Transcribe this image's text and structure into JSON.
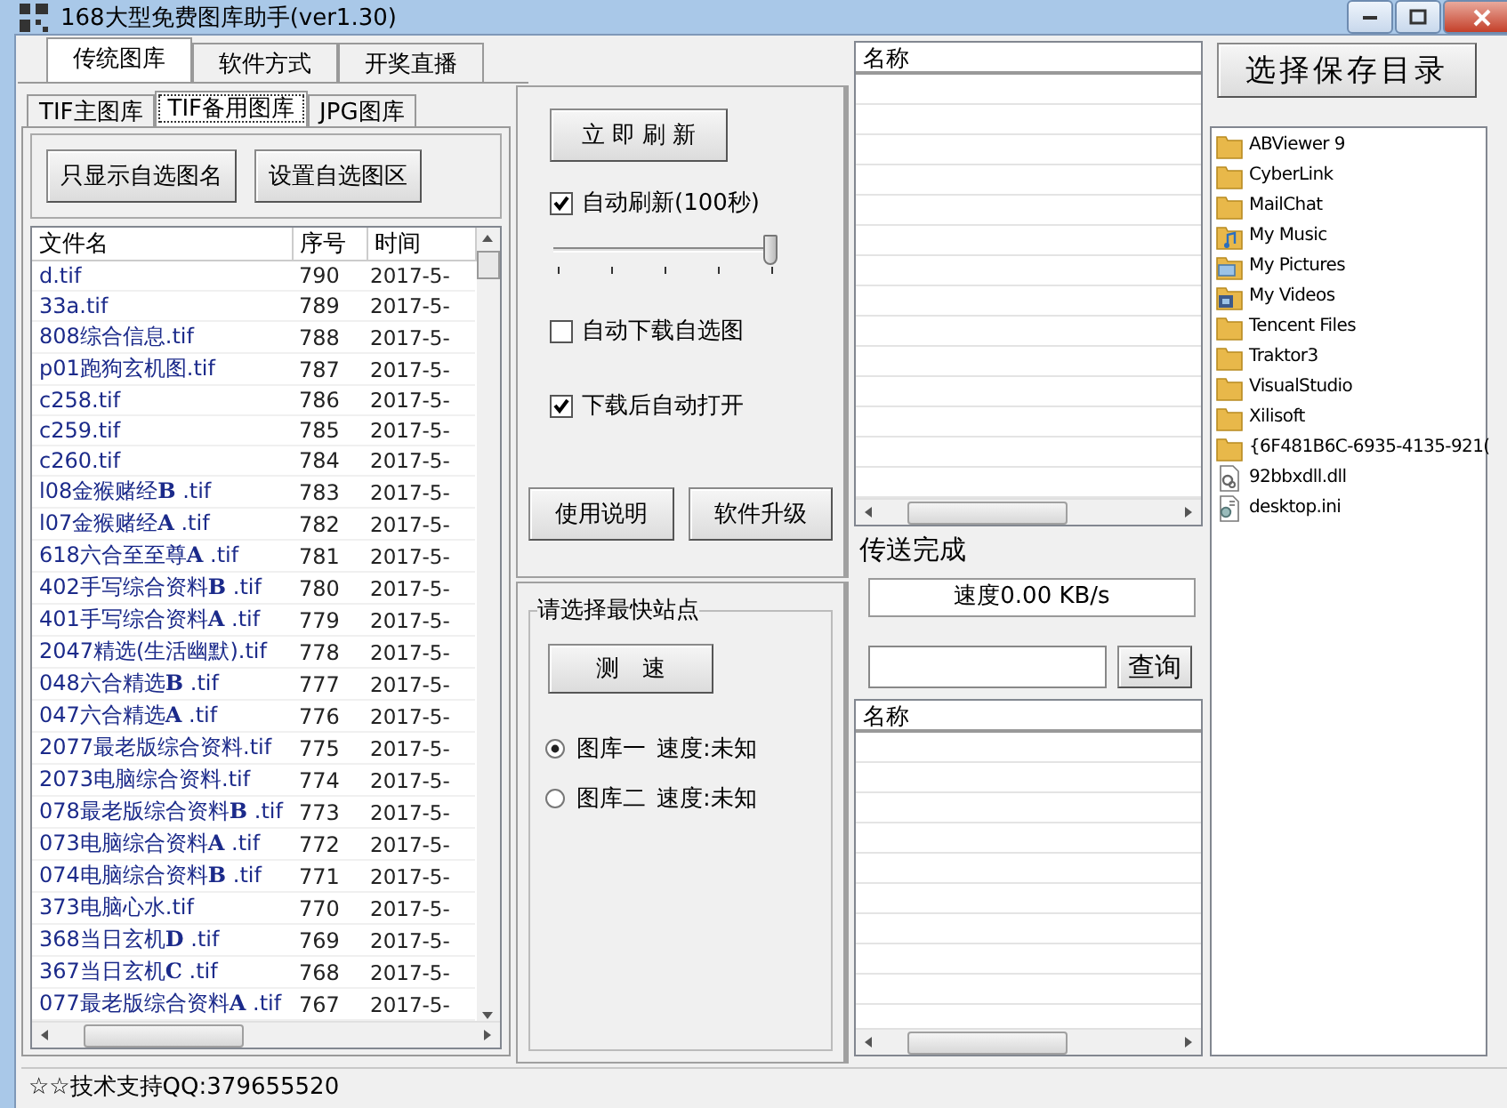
{
  "window": {
    "title": "168大型免费图库助手(ver1.30)"
  },
  "tabs": [
    {
      "label": "传统图库",
      "selected": true
    },
    {
      "label": "软件方式",
      "selected": false
    },
    {
      "label": "开奖直播",
      "selected": false
    }
  ],
  "sub_tabs": [
    {
      "label": "TIF主图库",
      "selected": false
    },
    {
      "label": "TIF备用图库",
      "selected": true
    },
    {
      "label": "JPG图库",
      "selected": false
    }
  ],
  "filter_buttons": [
    "只显示自选图名",
    "设置自选图区"
  ],
  "file_table": {
    "columns": [
      "文件名",
      "序号",
      "时间"
    ],
    "rows": [
      {
        "name": "d.tif",
        "number": "790",
        "time": "2017-5-"
      },
      {
        "name": "33a.tif",
        "number": "789",
        "time": "2017-5-"
      },
      {
        "name": "808综合信息.tif",
        "number": "788",
        "time": "2017-5-"
      },
      {
        "name": "p01跑狗玄机图.tif",
        "number": "787",
        "time": "2017-5-"
      },
      {
        "name": "c258.tif",
        "number": "786",
        "time": "2017-5-"
      },
      {
        "name": "c259.tif",
        "number": "785",
        "time": "2017-5-"
      },
      {
        "name": "c260.tif",
        "number": "784",
        "time": "2017-5-"
      },
      {
        "name": "l08金猴赌经**B** .tif",
        "number": "783",
        "time": "2017-5-"
      },
      {
        "name": "l07金猴赌经**A** .tif",
        "number": "782",
        "time": "2017-5-"
      },
      {
        "name": "618六合至至尊**A** .tif",
        "number": "781",
        "time": "2017-5-"
      },
      {
        "name": "402手写综合资料**B** .tif",
        "number": "780",
        "time": "2017-5-"
      },
      {
        "name": "401手写综合资料**A** .tif",
        "number": "779",
        "time": "2017-5-"
      },
      {
        "name": "2047精选(生活幽默).tif",
        "number": "778",
        "time": "2017-5-"
      },
      {
        "name": "048六合精选**B** .tif",
        "number": "777",
        "time": "2017-5-"
      },
      {
        "name": "047六合精选**A** .tif",
        "number": "776",
        "time": "2017-5-"
      },
      {
        "name": "2077最老版综合资料.tif",
        "number": "775",
        "time": "2017-5-"
      },
      {
        "name": "2073电脑综合资料.tif",
        "number": "774",
        "time": "2017-5-"
      },
      {
        "name": "078最老版综合资料**B** .tif",
        "number": "773",
        "time": "2017-5-"
      },
      {
        "name": "073电脑综合资料**A** .tif",
        "number": "772",
        "time": "2017-5-"
      },
      {
        "name": "074电脑综合资料**B** .tif",
        "number": "771",
        "time": "2017-5-"
      },
      {
        "name": "373电脑心水.tif",
        "number": "770",
        "time": "2017-5-"
      },
      {
        "name": "368当日玄机**D** .tif",
        "number": "769",
        "time": "2017-5-"
      },
      {
        "name": "367当日玄机**C** .tif",
        "number": "768",
        "time": "2017-5-"
      },
      {
        "name": "077最老版综合资料**A** .tif",
        "number": "767",
        "time": "2017-5-"
      }
    ]
  },
  "controls": {
    "refresh_button": "立 即 刷 新",
    "auto_refresh": {
      "label": "自动刷新(100秒)",
      "checked": true
    },
    "interval_slider": {
      "level": 1
    },
    "auto_download": {
      "label": "自动下载自选图",
      "checked": false
    },
    "auto_open": {
      "label": "下载后自动打开",
      "checked": true
    },
    "buttons": [
      "使用说明",
      "软件升级"
    ]
  },
  "server_group": {
    "title": "请选择最快站点",
    "test_button": "测　速",
    "servers": [
      {
        "label": "图库一",
        "speed": "速度:未知",
        "selected": true
      },
      {
        "label": "图库二",
        "speed": "速度:未知",
        "selected": false
      }
    ]
  },
  "download_list": {
    "columns": [
      "名称"
    ]
  },
  "transfer_status": "传送完成",
  "speed": "速度0.00 KB/s",
  "query_button": "查询",
  "result_list": {
    "columns": [
      "名称"
    ]
  },
  "save_dir_button": "选择保存目录",
  "files": [
    {
      "name": "ABViewer 9",
      "kind": "folder"
    },
    {
      "name": "CyberLink",
      "kind": "folder"
    },
    {
      "name": "MailChat",
      "kind": "folder"
    },
    {
      "name": "My Music",
      "kind": "music"
    },
    {
      "name": "My Pictures",
      "kind": "pictures"
    },
    {
      "name": "My Videos",
      "kind": "videos"
    },
    {
      "name": "Tencent Files",
      "kind": "folder"
    },
    {
      "name": "Traktor3",
      "kind": "folder"
    },
    {
      "name": "VisualStudio",
      "kind": "folder"
    },
    {
      "name": "Xilisoft",
      "kind": "folder"
    },
    {
      "name": "{6F481B6C-6935-4135-921(",
      "kind": "folder"
    },
    {
      "name": "92bbxdll.dll",
      "kind": "dll"
    },
    {
      "name": "desktop.ini",
      "kind": "ini"
    }
  ],
  "status_bar": "☆☆技术支持QQ:379655520"
}
